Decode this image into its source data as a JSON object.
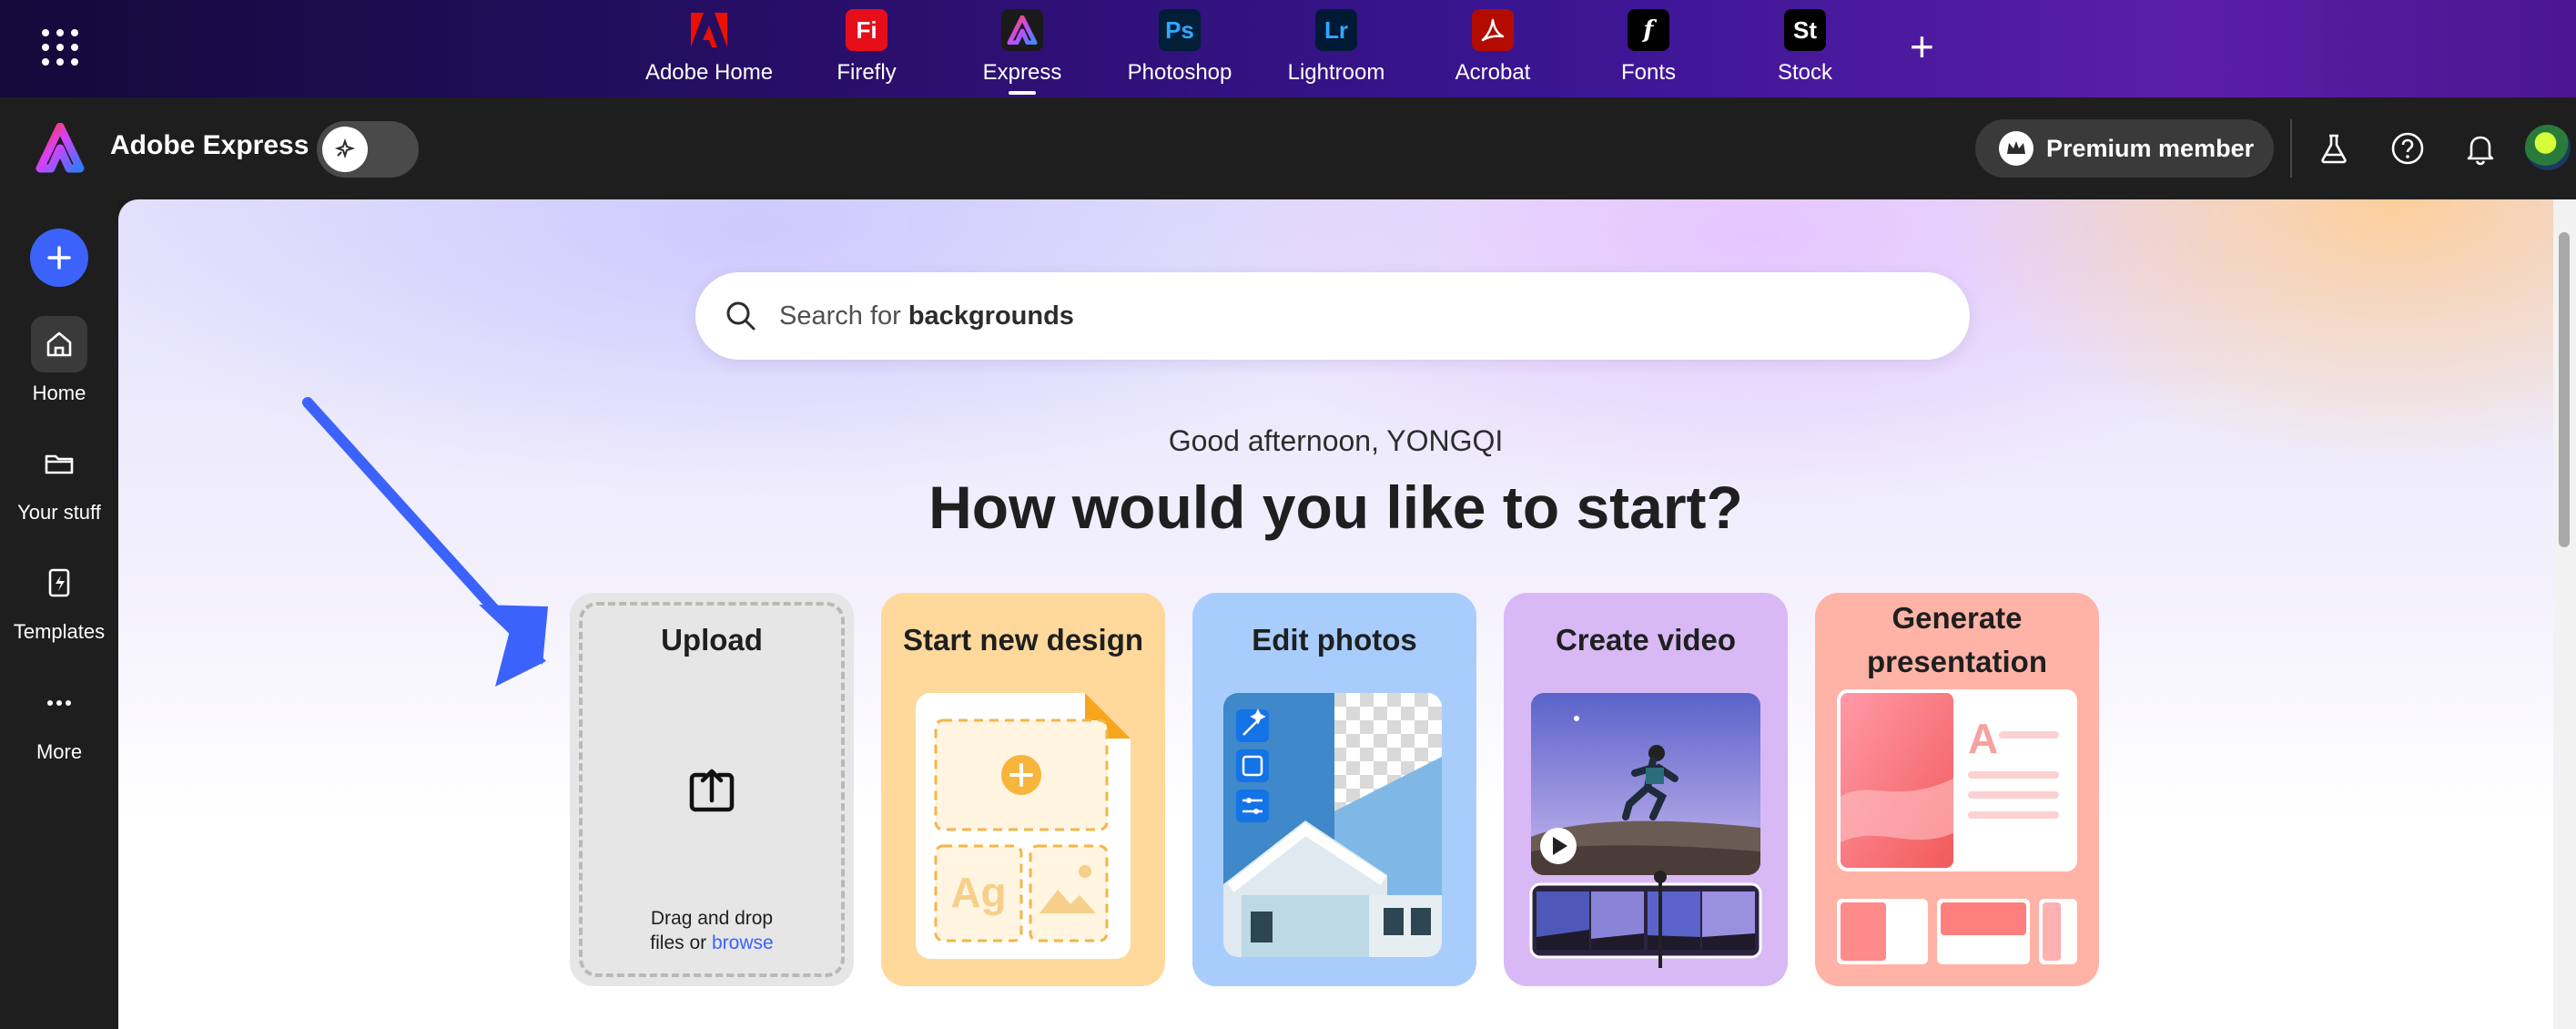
{
  "apps": [
    {
      "id": "adobe-home",
      "label": "Adobe Home",
      "glyph": "A",
      "color": "#eb1000"
    },
    {
      "id": "firefly",
      "label": "Firefly",
      "glyph": "Fi",
      "color": "#e60e1a"
    },
    {
      "id": "express",
      "label": "Express",
      "glyph": "A",
      "color": "#1a1a1a",
      "active": true
    },
    {
      "id": "photoshop",
      "label": "Photoshop",
      "glyph": "Ps",
      "color": "#001e36"
    },
    {
      "id": "lightroom",
      "label": "Lightroom",
      "glyph": "Lr",
      "color": "#001a36"
    },
    {
      "id": "acrobat",
      "label": "Acrobat",
      "glyph": "A",
      "color": "#b30b00"
    },
    {
      "id": "fonts",
      "label": "Fonts",
      "glyph": "f",
      "color": "#000000"
    },
    {
      "id": "stock",
      "label": "Stock",
      "glyph": "St",
      "color": "#000000"
    }
  ],
  "add_app_icon": "plus-icon",
  "header": {
    "brand": "Adobe Express",
    "premium_label": "Premium member"
  },
  "rail": {
    "create_icon": "plus-icon",
    "items": [
      {
        "id": "home",
        "label": "Home",
        "icon": "home-icon",
        "active": true
      },
      {
        "id": "your-stuff",
        "label": "Your stuff",
        "icon": "folder-icon"
      },
      {
        "id": "templates",
        "label": "Templates",
        "icon": "templates-icon"
      },
      {
        "id": "more",
        "label": "More",
        "icon": "more-icon"
      }
    ]
  },
  "main": {
    "search_prefix": "Search for ",
    "search_keyword": "backgrounds",
    "greeting": "Good afternoon, YONGQI",
    "headline": "How would you like to start?",
    "cards": [
      {
        "id": "upload",
        "title": "Upload",
        "drop_line1": "Drag and drop",
        "drop_line2_prefix": "files or ",
        "drop_link": "browse"
      },
      {
        "id": "start-new-design",
        "title": "Start new design",
        "placeholder_text": "Ag"
      },
      {
        "id": "edit-photos",
        "title": "Edit photos"
      },
      {
        "id": "create-video",
        "title": "Create video"
      },
      {
        "id": "generate-presentation",
        "title": "Generate presentation"
      }
    ]
  },
  "colors": {
    "accent": "#3b63fb",
    "arrow": "#3b63fb"
  }
}
